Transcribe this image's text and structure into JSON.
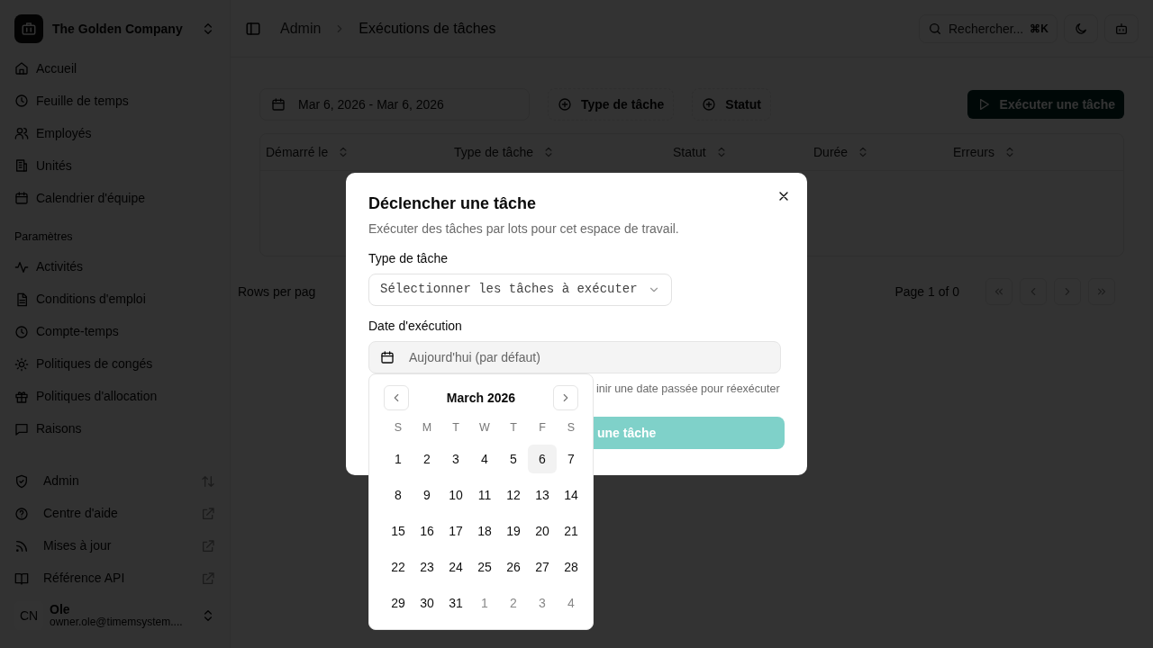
{
  "workspace": {
    "name": "The Golden Company"
  },
  "sidebar": {
    "main_items": [
      {
        "label": "Accueil"
      },
      {
        "label": "Feuille de temps"
      },
      {
        "label": "Employés"
      },
      {
        "label": "Unités"
      },
      {
        "label": "Calendrier d'équipe"
      }
    ],
    "section_title": "Paramètres",
    "settings_items": [
      {
        "label": "Activités"
      },
      {
        "label": "Conditions d'emploi"
      },
      {
        "label": "Compte-temps"
      },
      {
        "label": "Politiques de congés"
      },
      {
        "label": "Politiques d'allocation"
      },
      {
        "label": "Raisons"
      }
    ],
    "footer_items": [
      {
        "label": "Admin",
        "kind": "switch"
      },
      {
        "label": "Centre d'aide",
        "kind": "external"
      },
      {
        "label": "Mises à jour",
        "kind": "external"
      },
      {
        "label": "Référence API",
        "kind": "external"
      }
    ],
    "user": {
      "initials": "CN",
      "name": "Ole",
      "email": "owner.ole@timemsystem...."
    }
  },
  "header": {
    "breadcrumb": [
      {
        "label": "Admin"
      },
      {
        "label": "Exécutions de tâches"
      }
    ],
    "search": {
      "placeholder": "Rechercher...",
      "shortcut": "⌘K"
    }
  },
  "toolbar": {
    "date_range": "Mar 6, 2026 - Mar 6, 2026",
    "filters": [
      "Type de tâche",
      "Statut"
    ],
    "run_button": "Exécuter une tâche"
  },
  "table": {
    "columns": [
      "Démarré le",
      "Type de tâche",
      "Statut",
      "Durée",
      "Erreurs"
    ]
  },
  "pagination": {
    "rows_per_page": "Rows per pag",
    "page": "Page 1 of 0"
  },
  "modal": {
    "title": "Déclencher une tâche",
    "description": "Exécuter des tâches par lots pour cet espace de travail.",
    "task_type": {
      "label": "Type de tâche",
      "placeholder": "Sélectionner les tâches à exécuter"
    },
    "date": {
      "label": "Date d'exécution",
      "placeholder": "Aujourd'hui (par défaut)"
    },
    "help": "inir une date passée pour réexécuter",
    "submit": {
      "label": "une tâche",
      "disabled": true
    }
  },
  "calendar": {
    "month": "March 2026",
    "weekdays": [
      "S",
      "M",
      "T",
      "W",
      "T",
      "F",
      "S"
    ],
    "days": [
      {
        "label": "1",
        "outside": false,
        "selected": false
      },
      {
        "label": "2",
        "outside": false,
        "selected": false
      },
      {
        "label": "3",
        "outside": false,
        "selected": false
      },
      {
        "label": "4",
        "outside": false,
        "selected": false
      },
      {
        "label": "5",
        "outside": false,
        "selected": false
      },
      {
        "label": "6",
        "outside": false,
        "selected": true
      },
      {
        "label": "7",
        "outside": false,
        "selected": false
      },
      {
        "label": "8",
        "outside": false,
        "selected": false
      },
      {
        "label": "9",
        "outside": false,
        "selected": false
      },
      {
        "label": "10",
        "outside": false,
        "selected": false
      },
      {
        "label": "11",
        "outside": false,
        "selected": false
      },
      {
        "label": "12",
        "outside": false,
        "selected": false
      },
      {
        "label": "13",
        "outside": false,
        "selected": false
      },
      {
        "label": "14",
        "outside": false,
        "selected": false
      },
      {
        "label": "15",
        "outside": false,
        "selected": false
      },
      {
        "label": "16",
        "outside": false,
        "selected": false
      },
      {
        "label": "17",
        "outside": false,
        "selected": false
      },
      {
        "label": "18",
        "outside": false,
        "selected": false
      },
      {
        "label": "19",
        "outside": false,
        "selected": false
      },
      {
        "label": "20",
        "outside": false,
        "selected": false
      },
      {
        "label": "21",
        "outside": false,
        "selected": false
      },
      {
        "label": "22",
        "outside": false,
        "selected": false
      },
      {
        "label": "23",
        "outside": false,
        "selected": false
      },
      {
        "label": "24",
        "outside": false,
        "selected": false
      },
      {
        "label": "25",
        "outside": false,
        "selected": false
      },
      {
        "label": "26",
        "outside": false,
        "selected": false
      },
      {
        "label": "27",
        "outside": false,
        "selected": false
      },
      {
        "label": "28",
        "outside": false,
        "selected": false
      },
      {
        "label": "29",
        "outside": false,
        "selected": false
      },
      {
        "label": "30",
        "outside": false,
        "selected": false
      },
      {
        "label": "31",
        "outside": false,
        "selected": false
      },
      {
        "label": "1",
        "outside": true,
        "selected": false
      },
      {
        "label": "2",
        "outside": true,
        "selected": false
      },
      {
        "label": "3",
        "outside": true,
        "selected": false
      },
      {
        "label": "4",
        "outside": true,
        "selected": false
      }
    ]
  }
}
